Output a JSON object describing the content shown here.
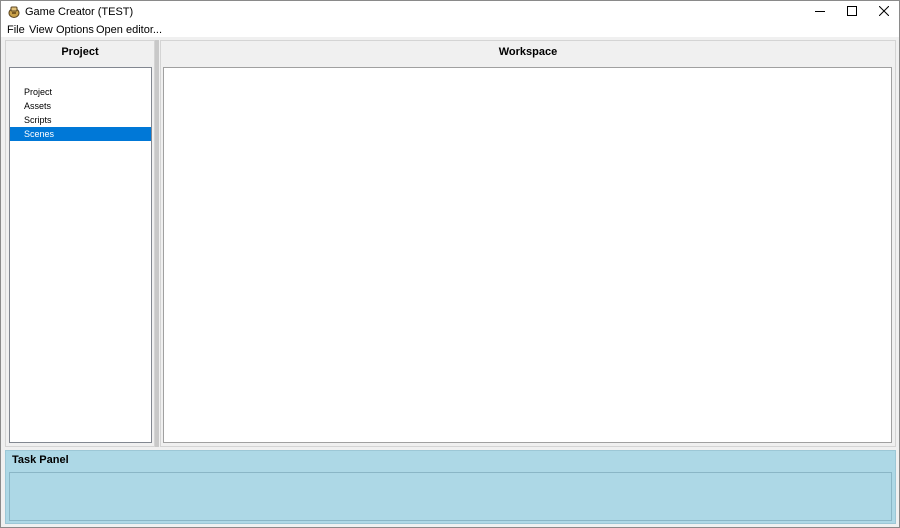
{
  "window": {
    "title": "Game Creator (TEST)",
    "icon": "game-creator-icon",
    "controls": {
      "minimize": "minimize-icon",
      "maximize": "maximize-icon",
      "close": "close-icon"
    }
  },
  "menubar": {
    "items": [
      "File",
      "View",
      "Options",
      "Open editor..."
    ]
  },
  "project_panel": {
    "title": "Project",
    "tree": [
      {
        "label": "Project",
        "selected": false
      },
      {
        "label": "Assets",
        "selected": false
      },
      {
        "label": "Scripts",
        "selected": false
      },
      {
        "label": "Scenes",
        "selected": true
      }
    ]
  },
  "workspace": {
    "title": "Workspace"
  },
  "task_panel": {
    "title": "Task Panel"
  },
  "colors": {
    "selection": "#0078d7",
    "task_panel_bg": "#add8e6"
  }
}
